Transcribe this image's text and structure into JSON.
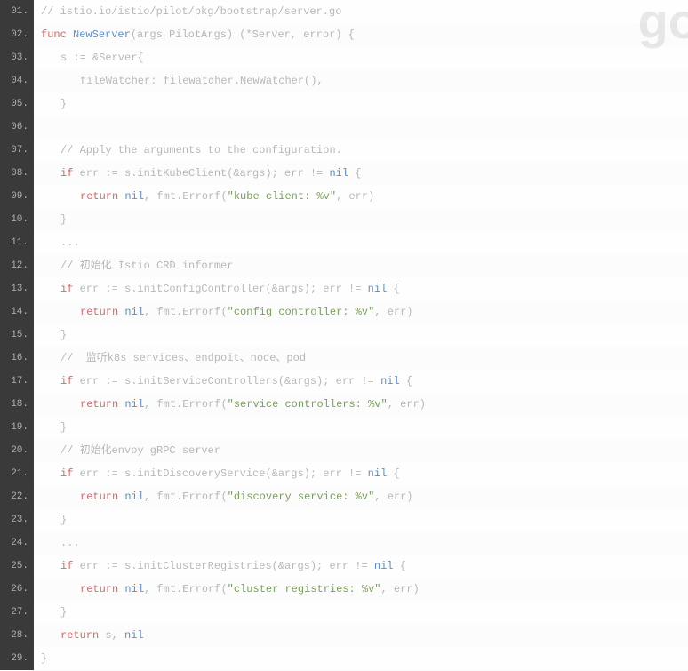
{
  "watermark": "go",
  "lines": [
    {
      "num": "01.",
      "indent": 0,
      "tokens": [
        {
          "c": "comment",
          "t": "// istio.io/istio/pilot/pkg/bootstrap/server.go"
        }
      ]
    },
    {
      "num": "02.",
      "indent": 0,
      "tokens": [
        {
          "c": "keyword",
          "t": "func"
        },
        {
          "c": "plain",
          "t": " "
        },
        {
          "c": "funcname",
          "t": "NewServer"
        },
        {
          "c": "punct",
          "t": "(args PilotArgs) (*Server, error) {"
        }
      ]
    },
    {
      "num": "03.",
      "indent": 1,
      "tokens": [
        {
          "c": "plain",
          "t": "s := &Server{"
        }
      ]
    },
    {
      "num": "04.",
      "indent": 2,
      "tokens": [
        {
          "c": "plain",
          "t": "fileWatcher: filewatcher.NewWatcher(),"
        }
      ]
    },
    {
      "num": "05.",
      "indent": 1,
      "tokens": [
        {
          "c": "punct",
          "t": "}"
        }
      ]
    },
    {
      "num": "06.",
      "indent": 0,
      "tokens": [
        {
          "c": "plain",
          "t": " "
        }
      ]
    },
    {
      "num": "07.",
      "indent": 1,
      "tokens": [
        {
          "c": "comment",
          "t": "// Apply the arguments to the configuration."
        }
      ]
    },
    {
      "num": "08.",
      "indent": 1,
      "tokens": [
        {
          "c": "keyword",
          "t": "if"
        },
        {
          "c": "plain",
          "t": " err := s.initKubeClient(&args); err != "
        },
        {
          "c": "nil",
          "t": "nil"
        },
        {
          "c": "plain",
          "t": " {"
        }
      ]
    },
    {
      "num": "09.",
      "indent": 2,
      "tokens": [
        {
          "c": "keyword",
          "t": "return"
        },
        {
          "c": "plain",
          "t": " "
        },
        {
          "c": "nil",
          "t": "nil"
        },
        {
          "c": "plain",
          "t": ", fmt.Errorf("
        },
        {
          "c": "string",
          "t": "\"kube client: %v\""
        },
        {
          "c": "plain",
          "t": ", err)"
        }
      ]
    },
    {
      "num": "10.",
      "indent": 1,
      "tokens": [
        {
          "c": "punct",
          "t": "}"
        }
      ]
    },
    {
      "num": "11.",
      "indent": 1,
      "tokens": [
        {
          "c": "plain",
          "t": "..."
        }
      ]
    },
    {
      "num": "12.",
      "indent": 1,
      "tokens": [
        {
          "c": "comment",
          "t": "// 初始化 Istio CRD informer"
        }
      ]
    },
    {
      "num": "13.",
      "indent": 1,
      "tokens": [
        {
          "c": "keyword",
          "t": "if"
        },
        {
          "c": "plain",
          "t": " err := s.initConfigController(&args); err != "
        },
        {
          "c": "nil",
          "t": "nil"
        },
        {
          "c": "plain",
          "t": " {"
        }
      ]
    },
    {
      "num": "14.",
      "indent": 2,
      "tokens": [
        {
          "c": "keyword",
          "t": "return"
        },
        {
          "c": "plain",
          "t": " "
        },
        {
          "c": "nil",
          "t": "nil"
        },
        {
          "c": "plain",
          "t": ", fmt.Errorf("
        },
        {
          "c": "string",
          "t": "\"config controller: %v\""
        },
        {
          "c": "plain",
          "t": ", err)"
        }
      ]
    },
    {
      "num": "15.",
      "indent": 1,
      "tokens": [
        {
          "c": "punct",
          "t": "}"
        }
      ]
    },
    {
      "num": "16.",
      "indent": 1,
      "tokens": [
        {
          "c": "comment",
          "t": "//  监听k8s services、endpoit、node、pod"
        }
      ]
    },
    {
      "num": "17.",
      "indent": 1,
      "tokens": [
        {
          "c": "keyword",
          "t": "if"
        },
        {
          "c": "plain",
          "t": " err := s.initServiceControllers(&args); err != "
        },
        {
          "c": "nil",
          "t": "nil"
        },
        {
          "c": "plain",
          "t": " {"
        }
      ]
    },
    {
      "num": "18.",
      "indent": 2,
      "tokens": [
        {
          "c": "keyword",
          "t": "return"
        },
        {
          "c": "plain",
          "t": " "
        },
        {
          "c": "nil",
          "t": "nil"
        },
        {
          "c": "plain",
          "t": ", fmt.Errorf("
        },
        {
          "c": "string",
          "t": "\"service controllers: %v\""
        },
        {
          "c": "plain",
          "t": ", err)"
        }
      ]
    },
    {
      "num": "19.",
      "indent": 1,
      "tokens": [
        {
          "c": "punct",
          "t": "}"
        }
      ]
    },
    {
      "num": "20.",
      "indent": 1,
      "tokens": [
        {
          "c": "comment",
          "t": "// 初始化envoy gRPC server"
        }
      ]
    },
    {
      "num": "21.",
      "indent": 1,
      "tokens": [
        {
          "c": "keyword",
          "t": "if"
        },
        {
          "c": "plain",
          "t": " err := s.initDiscoveryService(&args); err != "
        },
        {
          "c": "nil",
          "t": "nil"
        },
        {
          "c": "plain",
          "t": " {"
        }
      ]
    },
    {
      "num": "22.",
      "indent": 2,
      "tokens": [
        {
          "c": "keyword",
          "t": "return"
        },
        {
          "c": "plain",
          "t": " "
        },
        {
          "c": "nil",
          "t": "nil"
        },
        {
          "c": "plain",
          "t": ", fmt.Errorf("
        },
        {
          "c": "string",
          "t": "\"discovery service: %v\""
        },
        {
          "c": "plain",
          "t": ", err)"
        }
      ]
    },
    {
      "num": "23.",
      "indent": 1,
      "tokens": [
        {
          "c": "punct",
          "t": "}"
        }
      ]
    },
    {
      "num": "24.",
      "indent": 1,
      "tokens": [
        {
          "c": "plain",
          "t": "..."
        }
      ]
    },
    {
      "num": "25.",
      "indent": 1,
      "tokens": [
        {
          "c": "keyword",
          "t": "if"
        },
        {
          "c": "plain",
          "t": " err := s.initClusterRegistries(&args); err != "
        },
        {
          "c": "nil",
          "t": "nil"
        },
        {
          "c": "plain",
          "t": " {"
        }
      ]
    },
    {
      "num": "26.",
      "indent": 2,
      "tokens": [
        {
          "c": "keyword",
          "t": "return"
        },
        {
          "c": "plain",
          "t": " "
        },
        {
          "c": "nil",
          "t": "nil"
        },
        {
          "c": "plain",
          "t": ", fmt.Errorf("
        },
        {
          "c": "string",
          "t": "\"cluster registries: %v\""
        },
        {
          "c": "plain",
          "t": ", err)"
        }
      ]
    },
    {
      "num": "27.",
      "indent": 1,
      "tokens": [
        {
          "c": "punct",
          "t": "}"
        }
      ]
    },
    {
      "num": "28.",
      "indent": 1,
      "tokens": [
        {
          "c": "keyword",
          "t": "return"
        },
        {
          "c": "plain",
          "t": " s, "
        },
        {
          "c": "nil",
          "t": "nil"
        }
      ]
    },
    {
      "num": "29.",
      "indent": 0,
      "tokens": [
        {
          "c": "punct",
          "t": "}"
        }
      ]
    }
  ]
}
